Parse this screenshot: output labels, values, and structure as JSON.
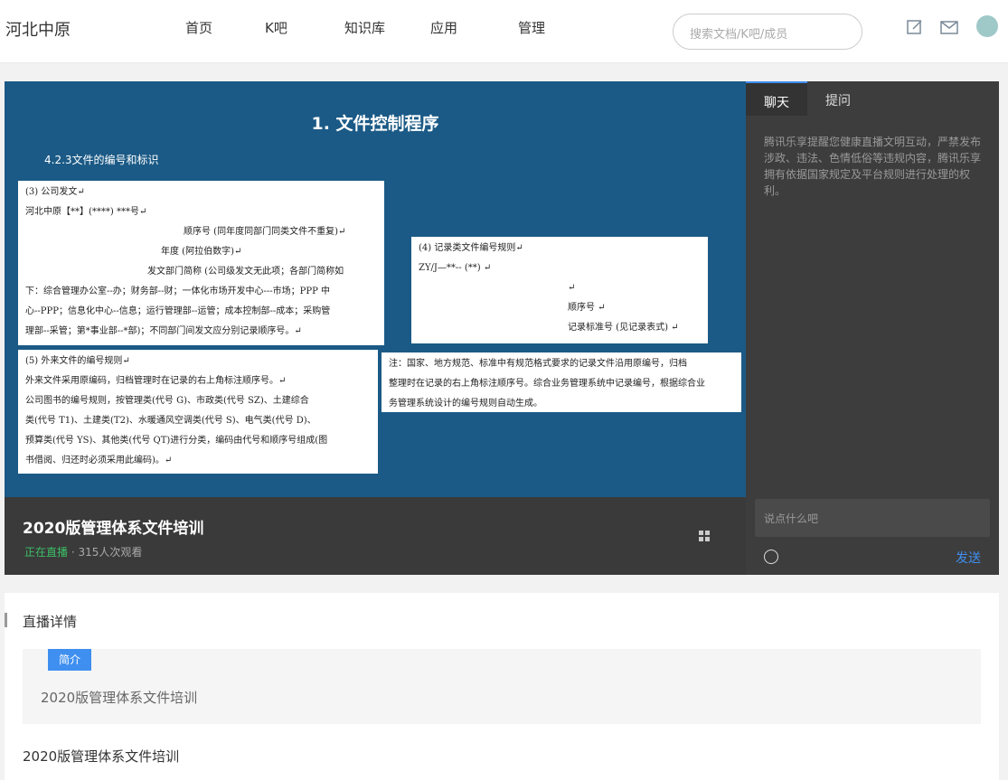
{
  "header": {
    "logo": "河北中原",
    "nav": [
      "首页",
      "K吧",
      "知识库",
      "应用",
      "管理"
    ],
    "search_placeholder": "搜索文档/K吧/成员"
  },
  "slide": {
    "title": "1. 文件控制程序",
    "subtitle": "4.2.3文件的编号和标识",
    "box1": [
      "(3) 公司发文↵",
      "河北中原【**】(****) ***号↵",
      "顺序号 (同年度同部门同类文件不重复)↵",
      "年度 (阿拉伯数字)↵",
      "发文部门简称 (公司级发文无此项；各部门简称如",
      "下：综合管理办公室--办；财务部--财；一体化市场开发中心---市场；PPP 中",
      "心--PPP；信息化中心--信息；运行管理部--运管；成本控制部--成本；采购管",
      "理部--采管；第*事业部--*部)；不同部门间发文应分别记录顺序号。↵"
    ],
    "box2": [
      "(4) 记录类文件编号规则↵",
      "ZY/J—**-- (**) ↵",
      "↵",
      "顺序号 ↵",
      "记录标准号 (见记录表式) ↵"
    ],
    "box3": [
      "(5) 外来文件的编号规则↵",
      "外来文件采用原编码，归档管理时在记录的右上角标注顺序号。↵",
      "公司图书的编号规则，按管理类(代号 G)、市政类(代号 SZ)、土建综合",
      "类(代号 T1)、土建类(T2)、水暖通风空调类(代号 S)、电气类(代号 D)、",
      "预算类(代号 YS)、其他类(代号 QT)进行分类，编码由代号和顺序号组成(图",
      "书借阅、归还时必须采用此编码)。↵"
    ],
    "box4": [
      "注：国家、地方规范、标准中有规范格式要求的记录文件沿用原编号，归档",
      "整理时在记录的右上角标注顺序号。综合业务管理系统中记录编号，根据综合业",
      "务管理系统设计的编号规则自动生成。"
    ]
  },
  "live": {
    "title": "2020版管理体系文件培训",
    "status": "正在直播",
    "viewers": "· 315人次观看"
  },
  "chat": {
    "tabs": [
      "聊天",
      "提问"
    ],
    "notice": "腾讯乐享提醒您健康直播文明互动，严禁发布涉政、违法、色情低俗等违规内容，腾讯乐享拥有依据国家规定及平台规则进行处理的权利。",
    "input_placeholder": "说点什么吧",
    "send": "发送"
  },
  "details": {
    "heading": "直播详情",
    "intro_tag": "简介",
    "intro_text": "2020版管理体系文件培训",
    "footer_title": "2020版管理体系文件培训"
  },
  "colors": {
    "accent": "#3f8ff0",
    "live_green": "#3cbf67"
  }
}
